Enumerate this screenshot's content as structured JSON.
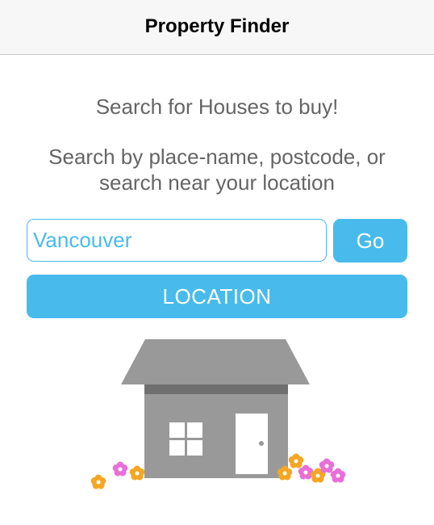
{
  "nav": {
    "title": "Property Finder"
  },
  "main": {
    "heading": "Search for Houses to buy!",
    "instructions_line1": "Search by place-name, postcode, or",
    "instructions_line2": "search near your location"
  },
  "search": {
    "value": "Vancouver",
    "go_label": "Go",
    "location_label": "LOCATION"
  },
  "colors": {
    "accent": "#48bbec",
    "text_secondary": "#656565",
    "house_gray": "#999999"
  },
  "illustration": {
    "icon": "house-icon"
  }
}
